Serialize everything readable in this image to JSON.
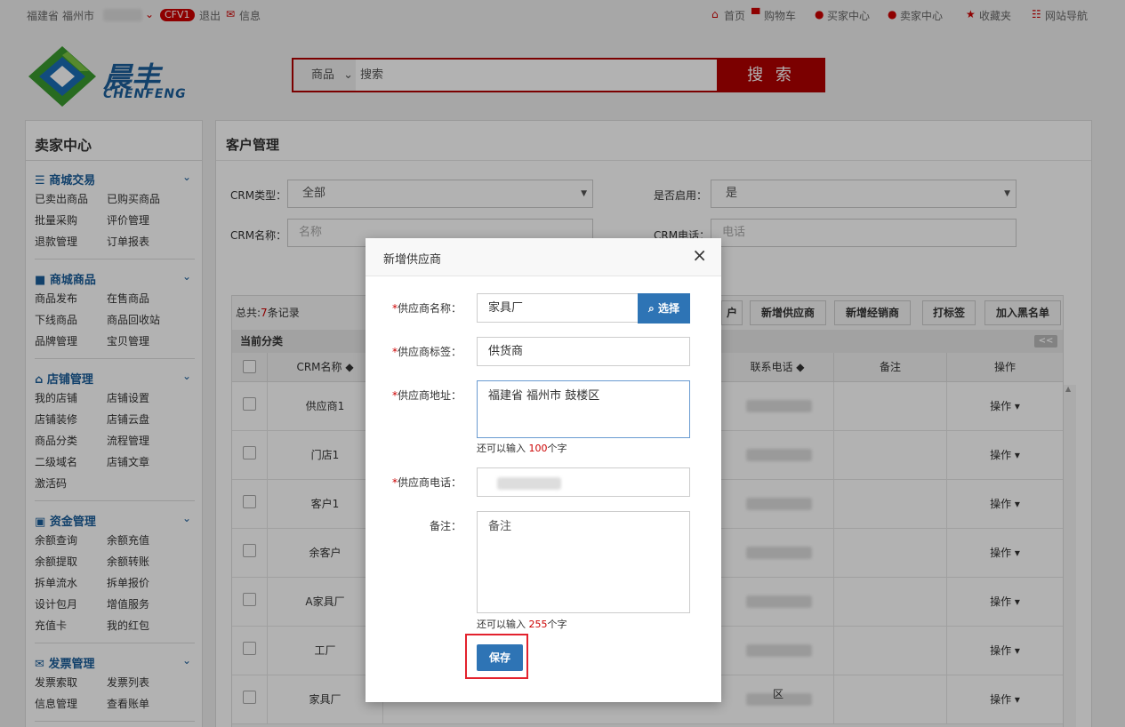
{
  "topbar": {
    "province": "福建省",
    "city": "福州市",
    "badge": "CFV1",
    "logout": "退出",
    "message": "信息",
    "home": "首页",
    "cart": "购物车",
    "buyer_center": "买家中心",
    "seller_center": "卖家中心",
    "favorites": "收藏夹",
    "site_nav": "网站导航"
  },
  "logo": {
    "cn": "晨丰",
    "en": "CHENFENG"
  },
  "search": {
    "category": "商品",
    "placeholder": "搜索",
    "button": "搜 索"
  },
  "sidebar": {
    "title": "卖家中心",
    "sections": [
      {
        "title": "商城交易",
        "icon": "list-icon",
        "items": [
          "已卖出商品",
          "已购买商品",
          "批量采购",
          "评价管理",
          "退款管理",
          "订单报表"
        ]
      },
      {
        "title": "商城商品",
        "icon": "truck-icon",
        "items": [
          "商品发布",
          "在售商品",
          "下线商品",
          "商品回收站",
          "品牌管理",
          "宝贝管理"
        ]
      },
      {
        "title": "店铺管理",
        "icon": "home-icon",
        "items": [
          "我的店铺",
          "店铺设置",
          "店铺装修",
          "店铺云盘",
          "商品分类",
          "流程管理",
          "二级域名",
          "店铺文章",
          "激活码"
        ]
      },
      {
        "title": "资金管理",
        "icon": "money-icon",
        "items": [
          "余额查询",
          "余额充值",
          "余额提取",
          "余额转账",
          "拆单流水",
          "拆单报价",
          "设计包月",
          "增值服务",
          "充值卡",
          "我的红包"
        ]
      },
      {
        "title": "发票管理",
        "icon": "mail-icon",
        "items": [
          "发票索取",
          "发票列表",
          "信息管理",
          "查看账单"
        ]
      }
    ]
  },
  "main": {
    "title": "客户管理",
    "filters": {
      "crm_type_label": "CRM类型：",
      "crm_type_value": "全部",
      "enabled_label": "是否启用：",
      "enabled_value": "是",
      "crm_name_label": "CRM名称：",
      "crm_name_placeholder": "名称",
      "crm_phone_label": "CRM电话：",
      "crm_phone_placeholder": "电话"
    },
    "total_prefix": "总共:",
    "total_count": "7",
    "total_suffix": "条记录",
    "buttons": [
      "户",
      "新增供应商",
      "新增经销商",
      "打标签",
      "加入黑名单"
    ],
    "category_label": "当前分类",
    "collapse": "<<",
    "columns": [
      "CRM名称 ◆",
      "联系电话 ◆",
      "备注",
      "操作"
    ],
    "rows": [
      {
        "name": "供应商1",
        "action": "操作 ▾"
      },
      {
        "name": "门店1",
        "action": "操作 ▾"
      },
      {
        "name": "客户1",
        "action": "操作 ▾"
      },
      {
        "name": "余客户",
        "action": "操作 ▾"
      },
      {
        "name": "A家具厂",
        "action": "操作 ▾"
      },
      {
        "name": "工厂",
        "action": "操作 ▾"
      },
      {
        "name": "家具厂",
        "action": "操作 ▾"
      }
    ],
    "row_tail": "区"
  },
  "modal": {
    "title": "新增供应商",
    "close": "×",
    "name_label": "供应商名称：",
    "name_value": "家具厂",
    "pick_button": "选择",
    "tag_label": "供应商标签：",
    "tag_value": "供货商",
    "address_label": "供应商地址：",
    "address_value": "福建省 福州市 鼓楼区",
    "address_hint_pre": "还可以输入",
    "address_hint_num": "100",
    "address_hint_post": "个字",
    "phone_label": "供应商电话：",
    "remark_label": "备注：",
    "remark_placeholder": "备注",
    "remark_hint_pre": "还可以输入",
    "remark_hint_num": "255",
    "remark_hint_post": "个字",
    "save": "保存",
    "required_mark": "*"
  }
}
